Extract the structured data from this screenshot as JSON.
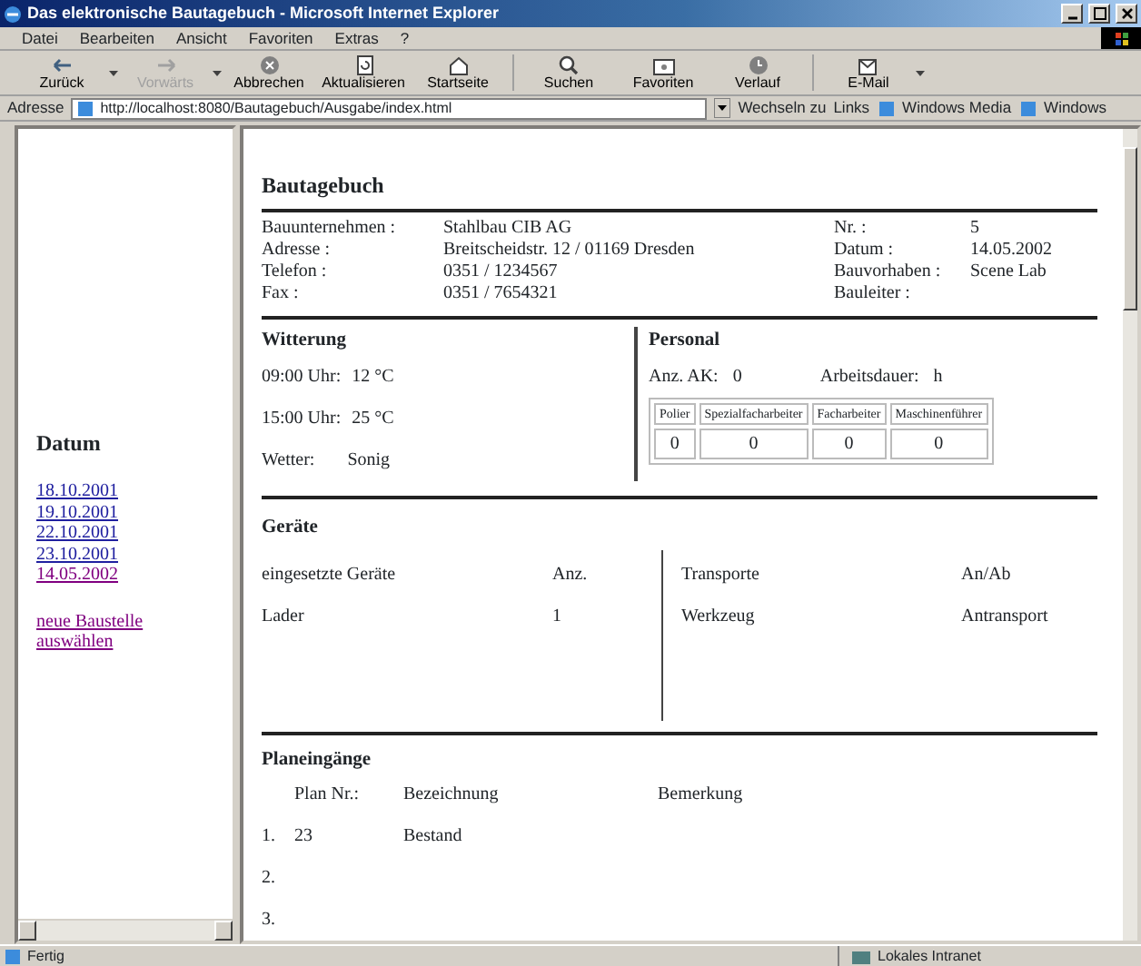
{
  "window": {
    "title": "Das elektronische Bautagebuch - Microsoft Internet Explorer"
  },
  "menu": [
    "Datei",
    "Bearbeiten",
    "Ansicht",
    "Favoriten",
    "Extras",
    "?"
  ],
  "toolbar": [
    {
      "label": "Zurück",
      "disabled": false,
      "dropdown": true
    },
    {
      "label": "Vorwärts",
      "disabled": true,
      "dropdown": true
    },
    {
      "label": "Abbrechen",
      "disabled": false,
      "dropdown": false
    },
    {
      "label": "Aktualisieren",
      "disabled": false,
      "dropdown": false
    },
    {
      "label": "Startseite",
      "disabled": false,
      "dropdown": false
    },
    {
      "label": "Suchen",
      "disabled": false,
      "dropdown": false
    },
    {
      "label": "Favoriten",
      "disabled": false,
      "dropdown": false
    },
    {
      "label": "Verlauf",
      "disabled": false,
      "dropdown": false
    },
    {
      "label": "E-Mail",
      "disabled": false,
      "dropdown": true
    }
  ],
  "address": {
    "label": "Adresse",
    "value": "http://localhost:8080/Bautagebuch/Ausgabe/index.html",
    "go": "Wechseln zu",
    "links_label": "Links",
    "links": [
      "Windows Media",
      "Windows"
    ]
  },
  "sidebar": {
    "heading": "Datum",
    "dates": [
      {
        "label": "18.10.2001",
        "visited": false
      },
      {
        "label": "19.10.2001",
        "visited": false
      },
      {
        "label": "22.10.2001",
        "visited": false
      },
      {
        "label": "23.10.2001",
        "visited": false
      },
      {
        "label": "14.05.2002",
        "visited": true
      }
    ],
    "new_site": {
      "label": "neue Baustelle auswählen",
      "visited": true
    }
  },
  "main": {
    "title": "Bautagebuch",
    "info": [
      {
        "label": "Bauunternehmen :",
        "value": "Stahlbau CIB AG",
        "label2": "Nr. :",
        "value2": "5"
      },
      {
        "label": "Adresse :",
        "value": "Breitscheidstr. 12 / 01169 Dresden",
        "label2": "Datum :",
        "value2": "14.05.2002"
      },
      {
        "label": "Telefon :",
        "value": "0351 / 1234567",
        "label2": "Bauvorhaben :",
        "value2": "Scene Lab"
      },
      {
        "label": "Fax :",
        "value": "0351 / 7654321",
        "label2": "Bauleiter :"
      }
    ],
    "weather": {
      "title": "Witterung",
      "readings": [
        {
          "time": "09:00 Uhr:",
          "temp": "12 °C"
        },
        {
          "time": "15:00 Uhr:",
          "temp": "25 °C"
        }
      ],
      "label": "Wetter:",
      "value": "Sonig"
    },
    "staff": {
      "title": "Personal",
      "count_label": "Anz. AK:",
      "count": "0",
      "duration_label": "Arbeitsdauer:",
      "duration": "h",
      "columns": [
        "Polier",
        "Spezialfacharbeiter",
        "Facharbeiter",
        "Maschinenführer"
      ],
      "values": [
        "0",
        "0",
        "0",
        "0"
      ]
    },
    "equipment": {
      "title": "Geräte",
      "columns": [
        "eingesetzte Geräte",
        "Anz."
      ],
      "rows": [
        [
          "Lader",
          "1"
        ]
      ],
      "transport_columns": [
        "Transporte",
        "An/Ab"
      ],
      "transport_rows": [
        [
          "Werkzeug",
          "Antransport"
        ]
      ]
    },
    "plans": {
      "title": "Planeingänge",
      "columns": [
        "Plan Nr.:",
        "Bezeichnung",
        "Bemerkung"
      ],
      "rows": [
        {
          "number": "1.",
          "plan": "23",
          "name": "Bestand"
        },
        {
          "number": "2."
        },
        {
          "number": "3."
        }
      ]
    }
  },
  "status_bar": {
    "text": "Fertig",
    "zone": "Lokales Intranet"
  }
}
